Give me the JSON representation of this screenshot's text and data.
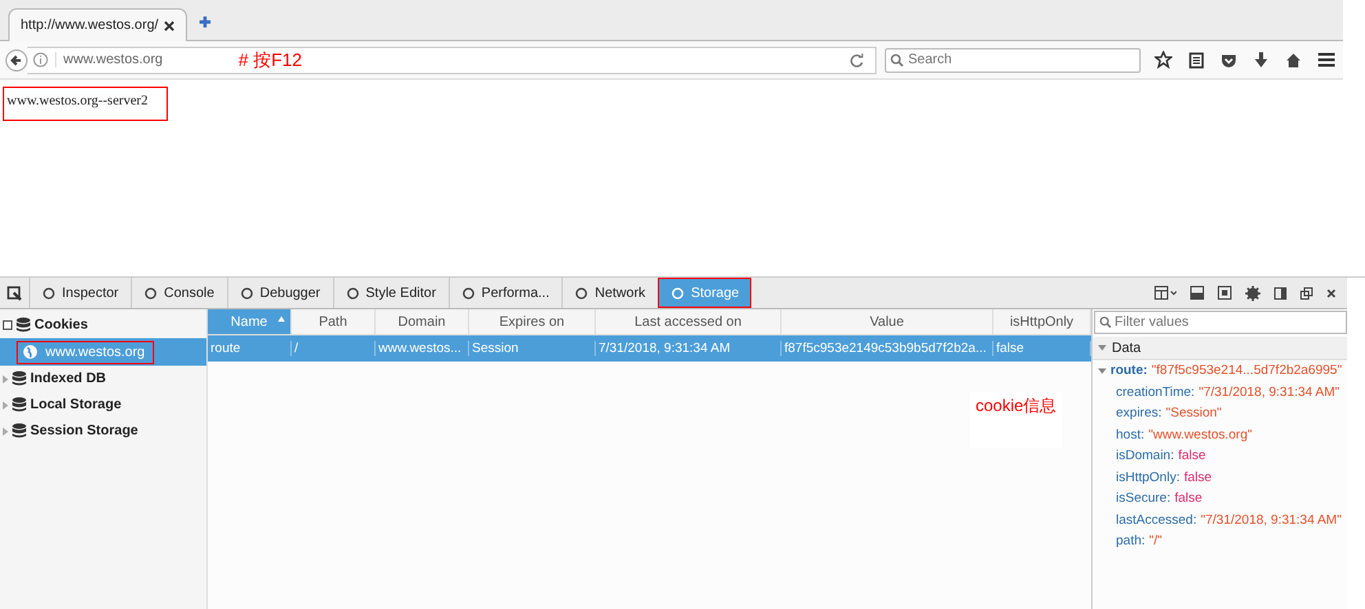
{
  "browser": {
    "tab": {
      "title": "http://www.westos.org/"
    },
    "address": {
      "url": "www.westos.org"
    },
    "note": "# 按F12",
    "search": {
      "placeholder": "Search"
    }
  },
  "page": {
    "text": "www.westos.org--server2",
    "marked": true
  },
  "devtools": {
    "tools": [
      {
        "label": "Inspector",
        "selected": false,
        "marked": false
      },
      {
        "label": "Console",
        "selected": false,
        "marked": false
      },
      {
        "label": "Debugger",
        "selected": false,
        "marked": false
      },
      {
        "label": "Style Editor",
        "selected": false,
        "marked": false
      },
      {
        "label": "Performa...",
        "selected": false,
        "marked": false
      },
      {
        "label": "Network",
        "selected": false,
        "marked": false
      },
      {
        "label": "Storage",
        "selected": true,
        "marked": true
      }
    ],
    "sidebar": [
      {
        "label": "Cookies",
        "expanded": true,
        "children": [
          {
            "label": "www.westos.org",
            "selected": true,
            "marked": true
          }
        ]
      },
      {
        "label": "Indexed DB",
        "expanded": false
      },
      {
        "label": "Local Storage",
        "expanded": false
      },
      {
        "label": "Session Storage",
        "expanded": false
      }
    ],
    "table": {
      "columns": [
        {
          "label": "Name",
          "sorted": true
        },
        {
          "label": "Path",
          "sorted": false
        },
        {
          "label": "Domain",
          "sorted": false
        },
        {
          "label": "Expires on",
          "sorted": false
        },
        {
          "label": "Last accessed on",
          "sorted": false
        },
        {
          "label": "Value",
          "sorted": false
        },
        {
          "label": "isHttpOnly",
          "sorted": false
        }
      ],
      "rows": [
        {
          "selected": true,
          "cells": [
            "route",
            "/",
            "www.westos...",
            "Session",
            "7/31/2018, 9:31:34 AM",
            "f87f5c953e2149c53b9b5d7f2b2a...",
            "false"
          ]
        }
      ]
    },
    "note": "cookie信息",
    "details": {
      "filter": {
        "placeholder": "Filter values"
      },
      "section": {
        "label": "Data",
        "expanded": true
      },
      "root": {
        "key": "route:",
        "value": "\"f87f5c953e214...5d7f2b2a6995\"",
        "kind": "string",
        "expanded": true
      },
      "entries": [
        {
          "key": "creationTime:",
          "value": "\"7/31/2018, 9:31:34 AM\"",
          "kind": "string"
        },
        {
          "key": "expires:",
          "value": "\"Session\"",
          "kind": "string"
        },
        {
          "key": "host:",
          "value": "\"www.westos.org\"",
          "kind": "string"
        },
        {
          "key": "isDomain:",
          "value": "false",
          "kind": "boolean"
        },
        {
          "key": "isHttpOnly:",
          "value": "false",
          "kind": "boolean"
        },
        {
          "key": "isSecure:",
          "value": "false",
          "kind": "boolean"
        },
        {
          "key": "lastAccessed:",
          "value": "\"7/31/2018, 9:31:34 AM\"",
          "kind": "string"
        },
        {
          "key": "path:",
          "value": "\"/\"",
          "kind": "string"
        }
      ]
    }
  }
}
